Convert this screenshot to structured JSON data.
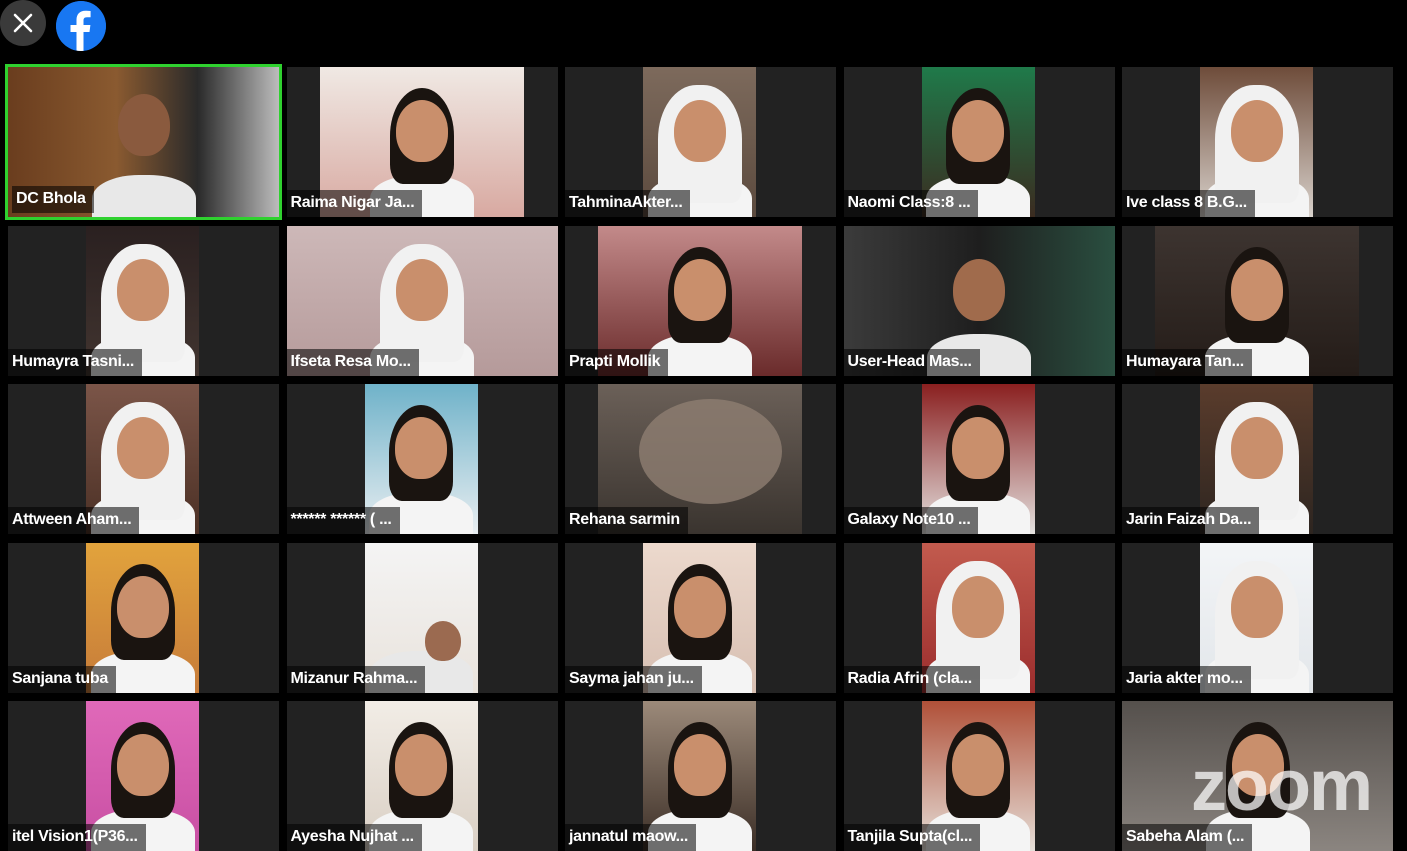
{
  "topbar": {
    "close_icon": "close-icon",
    "facebook_icon": "facebook-icon",
    "facebook_color": "#1877f2"
  },
  "watermark": "zoom",
  "active_speaker_color": "#2fd12f",
  "participants": [
    {
      "name": "DC Bhola",
      "active": true
    },
    {
      "name": "Raima Nigar Ja..."
    },
    {
      "name": "TahminaAkter..."
    },
    {
      "name": "Naomi Class:8 ..."
    },
    {
      "name": "Ive class 8   B.G..."
    },
    {
      "name": "Humayra Tasni..."
    },
    {
      "name": "Ifseta Resa Mo..."
    },
    {
      "name": "Prapti Mollik"
    },
    {
      "name": "User-Head Mas..."
    },
    {
      "name": "Humayara Tan..."
    },
    {
      "name": "Attween Aham..."
    },
    {
      "name": "****** ****** ( ..."
    },
    {
      "name": "Rehana sarmin"
    },
    {
      "name": "Galaxy Note10 ..."
    },
    {
      "name": "Jarin Faizah Da..."
    },
    {
      "name": "Sanjana tuba"
    },
    {
      "name": "Mizanur Rahma..."
    },
    {
      "name": "Sayma jahan ju..."
    },
    {
      "name": "Radia Afrin (cla..."
    },
    {
      "name": "Jaria akter mo..."
    },
    {
      "name": "itel Vision1(P36..."
    },
    {
      "name": "Ayesha Nujhat ..."
    },
    {
      "name": "jannatul maow..."
    },
    {
      "name": "Tanjila Supta(cl..."
    },
    {
      "name": "Sabeha Alam (..."
    }
  ]
}
